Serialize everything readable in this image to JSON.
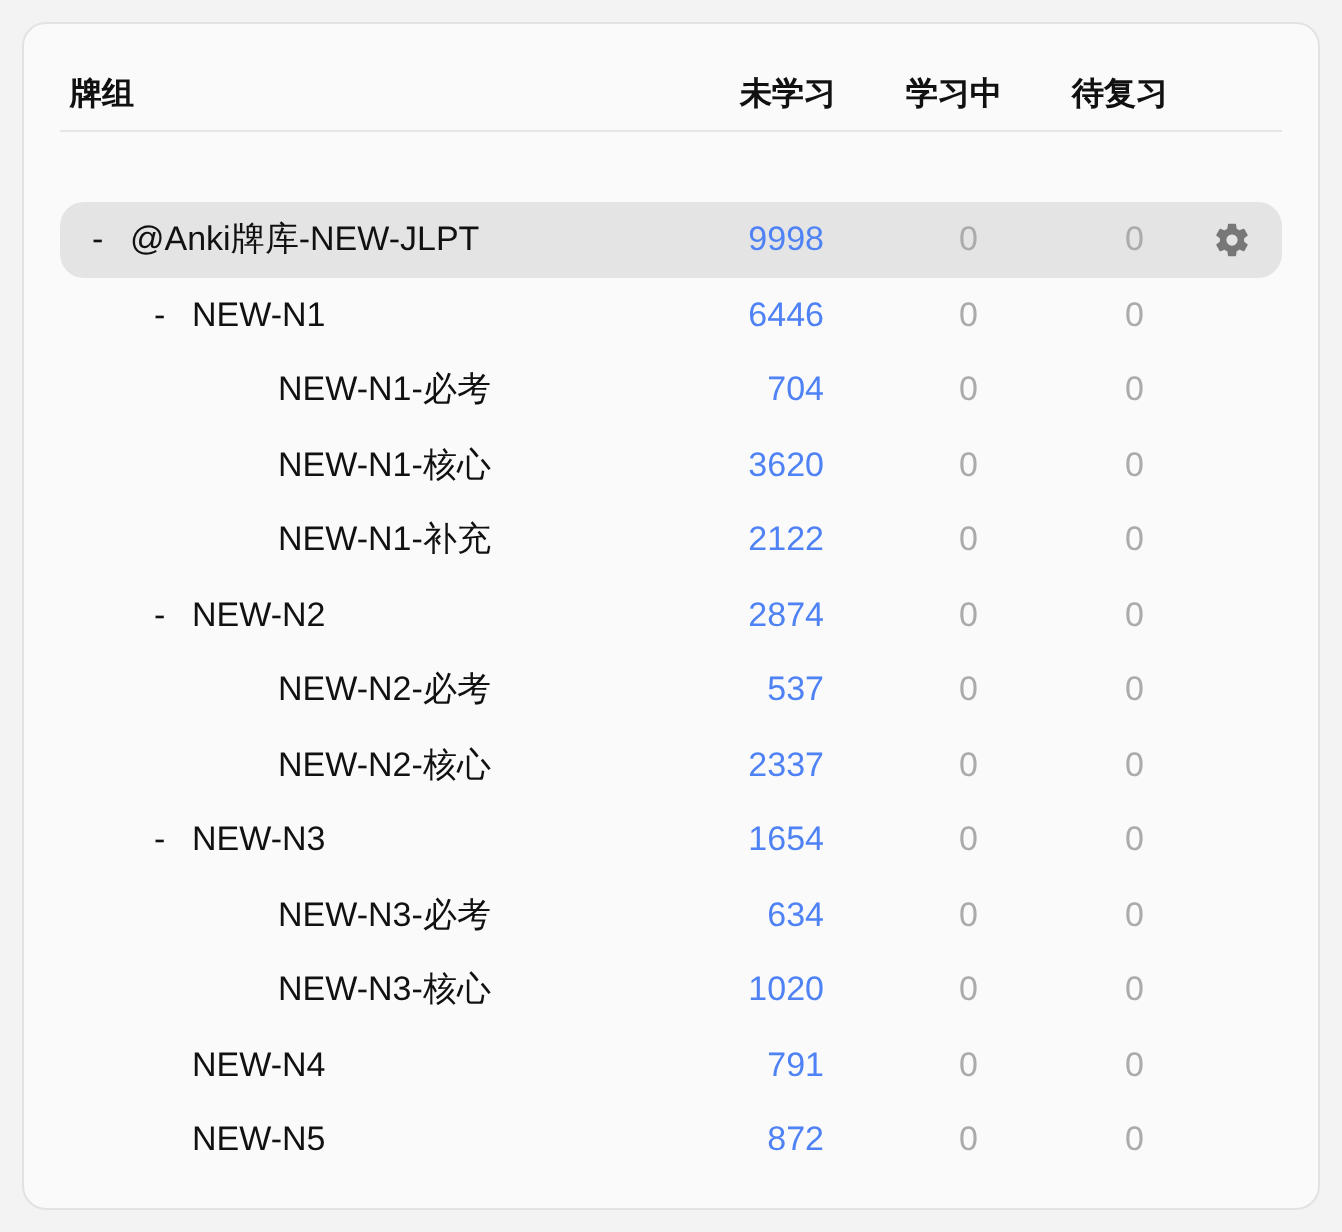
{
  "columns": [
    "牌组",
    "未学习",
    "学习中",
    "待复习"
  ],
  "decks": [
    {
      "name": "@Anki牌库-NEW-JLPT",
      "expander": "-",
      "selected": true,
      "new": "9998",
      "learning": "0",
      "review": "0",
      "children": [
        {
          "name": "NEW-N1",
          "expander": "-",
          "selected": false,
          "new": "6446",
          "learning": "0",
          "review": "0",
          "children": [
            {
              "name": "NEW-N1-必考",
              "selected": false,
              "new": "704",
              "learning": "0",
              "review": "0"
            },
            {
              "name": "NEW-N1-核心",
              "selected": false,
              "new": "3620",
              "learning": "0",
              "review": "0"
            },
            {
              "name": "NEW-N1-补充",
              "selected": false,
              "new": "2122",
              "learning": "0",
              "review": "0"
            }
          ]
        },
        {
          "name": "NEW-N2",
          "expander": "-",
          "selected": false,
          "new": "2874",
          "learning": "0",
          "review": "0",
          "children": [
            {
              "name": "NEW-N2-必考",
              "selected": false,
              "new": "537",
              "learning": "0",
              "review": "0"
            },
            {
              "name": "NEW-N2-核心",
              "selected": false,
              "new": "2337",
              "learning": "0",
              "review": "0"
            }
          ]
        },
        {
          "name": "NEW-N3",
          "expander": "-",
          "selected": false,
          "new": "1654",
          "learning": "0",
          "review": "0",
          "children": [
            {
              "name": "NEW-N3-必考",
              "selected": false,
              "new": "634",
              "learning": "0",
              "review": "0"
            },
            {
              "name": "NEW-N3-核心",
              "selected": false,
              "new": "1020",
              "learning": "0",
              "review": "0"
            }
          ]
        },
        {
          "name": "NEW-N4",
          "selected": false,
          "new": "791",
          "learning": "0",
          "review": "0"
        },
        {
          "name": "NEW-N5",
          "selected": false,
          "new": "872",
          "learning": "0",
          "review": "0"
        }
      ]
    }
  ]
}
